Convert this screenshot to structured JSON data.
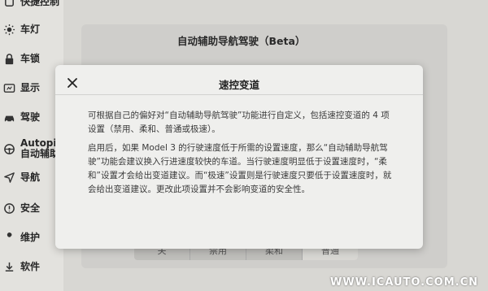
{
  "sidebar": {
    "items": [
      {
        "label": "快捷控制",
        "icon": "quick-controls-icon"
      },
      {
        "label": "车灯",
        "icon": "lights-icon"
      },
      {
        "label": "车锁",
        "icon": "lock-icon"
      },
      {
        "label": "显示",
        "icon": "display-icon"
      },
      {
        "label": "驾驶",
        "icon": "car-icon"
      },
      {
        "label": "Autopilot",
        "label2": "自动辅助",
        "icon": "steering-wheel-icon"
      },
      {
        "label": "导航",
        "icon": "navigation-icon"
      },
      {
        "label": "安全",
        "icon": "safety-icon"
      },
      {
        "label": "维护",
        "icon": "wrench-icon"
      },
      {
        "label": "软件",
        "icon": "download-icon"
      }
    ]
  },
  "background_panel": {
    "title": "自动辅助导航驾驶（Beta）",
    "tabs": [
      "关",
      "禁用",
      "柔和",
      "普通"
    ]
  },
  "modal": {
    "title": "速控变道",
    "paragraphs": [
      "可根据自己的偏好对“自动辅助导航驾驶”功能进行自定义，包括速控变道的 4 项设置（禁用、柔和、普通或极速）。",
      "启用后，如果 Model 3 的行驶速度低于所需的设置速度，那么“自动辅助导航驾驶”功能会建议换入行进速度较快的车道。当行驶速度明显低于设置速度时，“柔和”设置才会给出变道建议。而“极速”设置则是行驶速度只要低于设置速度时，就会给出变道建议。更改此项设置并不会影响变道的安全性。"
    ]
  },
  "watermark": "WWW.ICAUTO.COM.CN"
}
